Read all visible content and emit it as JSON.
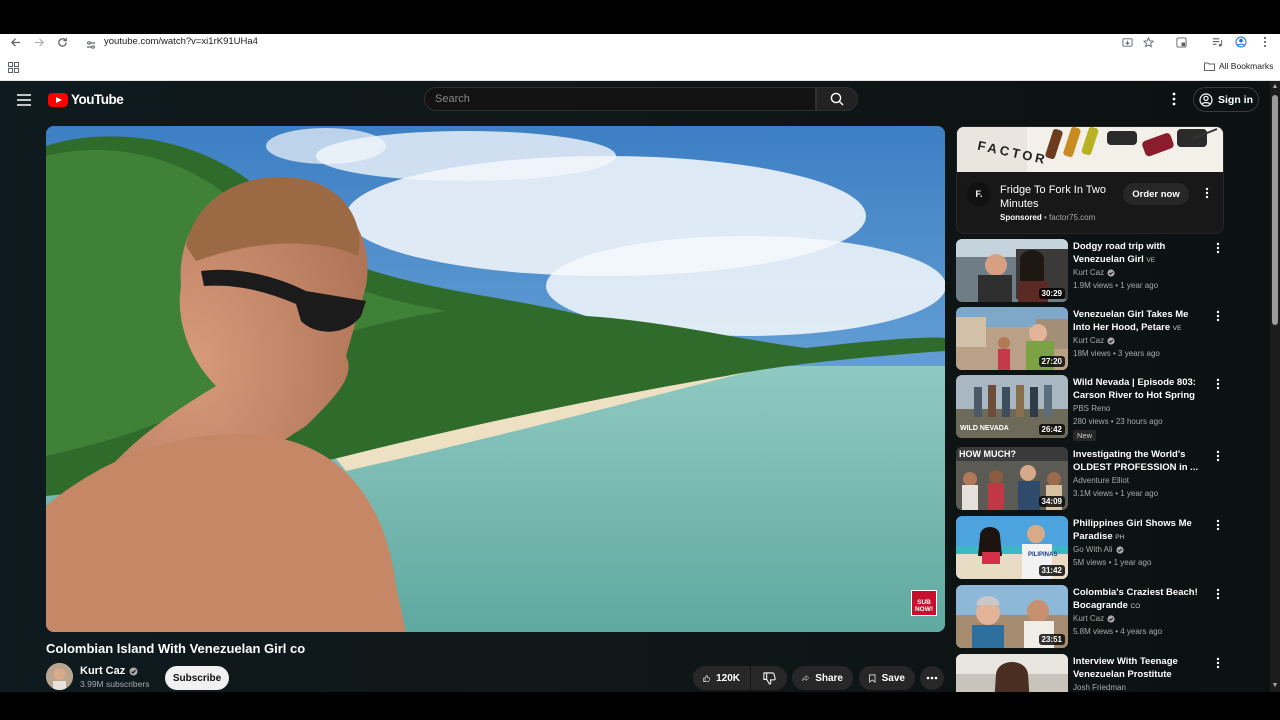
{
  "browser": {
    "url": "youtube.com/watch?v=xi1rK91UHa4",
    "bookmarks_label": "All Bookmarks"
  },
  "header": {
    "logo_text": "YouTube",
    "search_placeholder": "Search",
    "signin_label": "Sign in"
  },
  "video": {
    "title": "Colombian Island With Venezuelan Girl",
    "title_flag": "co",
    "subscribe_badge": "SUB NOW!",
    "channel": "Kurt Caz",
    "subscribers": "3.99M subscribers",
    "subscribe_label": "Subscribe",
    "likes": "120K",
    "share_label": "Share",
    "save_label": "Save"
  },
  "ad": {
    "logo_letter": "F.",
    "title": "Fridge To Fork In Two Minutes",
    "sponsored": "Sponsored",
    "domain": "factor75.com",
    "cta": "Order now"
  },
  "recommendations": [
    {
      "title": "Dodgy road trip with Venezuelan Girl",
      "flag": "VE",
      "channel": "Kurt Caz",
      "verified": true,
      "meta": "1.9M views • 1 year ago",
      "duration": "30:29",
      "badge": ""
    },
    {
      "title": "Venezuelan Girl Takes Me Into Her Hood, Petare",
      "flag": "VE",
      "channel": "Kurt Caz",
      "verified": true,
      "meta": "18M views • 3 years ago",
      "duration": "27:20",
      "badge": ""
    },
    {
      "title": "Wild Nevada | Episode 803: Carson River to Hot Spring",
      "flag": "",
      "channel": "PBS Reno",
      "verified": false,
      "meta": "280 views • 23 hours ago",
      "duration": "26:42",
      "badge": "New"
    },
    {
      "title": "Investigating the World's OLDEST PROFESSION in ...",
      "flag": "",
      "channel": "Adventure Elliot",
      "verified": false,
      "meta": "3.1M views • 1 year ago",
      "duration": "34:09",
      "badge": ""
    },
    {
      "title": "Philippines Girl Shows Me Paradise",
      "flag": "PH",
      "channel": "Go With Ali",
      "verified": true,
      "meta": "5M views • 1 year ago",
      "duration": "31:42",
      "badge": ""
    },
    {
      "title": "Colombia's Craziest Beach! Bocagrande",
      "flag": "CO",
      "channel": "Kurt Caz",
      "verified": true,
      "meta": "5.8M views • 4 years ago",
      "duration": "23:51",
      "badge": ""
    },
    {
      "title": "Interview With Teenage Venezuelan Prostitute",
      "flag": "",
      "channel": "Josh Friedman",
      "verified": false,
      "meta": "",
      "duration": "",
      "badge": ""
    }
  ],
  "thumb_texts": {
    "nevada": "WILD NEVADA",
    "how_much": "HOW MUCH?",
    "pilipinas": "PILIPINAS",
    "ad_banner": "FACTOR"
  }
}
